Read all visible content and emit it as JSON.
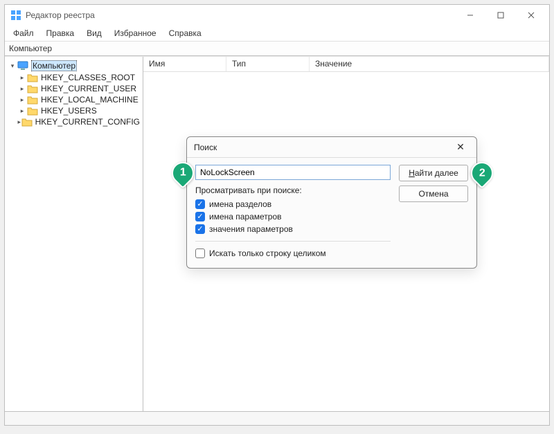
{
  "window": {
    "title": "Редактор реестра"
  },
  "menu": {
    "file": "Файл",
    "edit": "Правка",
    "view": "Вид",
    "favorites": "Избранное",
    "help": "Справка"
  },
  "address": "Компьютер",
  "tree": {
    "root": "Компьютер",
    "items": [
      "HKEY_CLASSES_ROOT",
      "HKEY_CURRENT_USER",
      "HKEY_LOCAL_MACHINE",
      "HKEY_USERS",
      "HKEY_CURRENT_CONFIG"
    ]
  },
  "columns": {
    "name": "Имя",
    "type": "Тип",
    "value": "Значение"
  },
  "dialog": {
    "title": "Поиск",
    "input_value": "NoLockScreen",
    "group_label": "Просматривать при поиске:",
    "cb_keys": "имена разделов",
    "cb_values": "имена параметров",
    "cb_data": "значения параметров",
    "cb_whole": "Искать только строку целиком",
    "find_next_u": "Н",
    "find_next_rest": "айти далее",
    "cancel": "Отмена",
    "checked": {
      "keys": true,
      "values": true,
      "data": true,
      "whole": false
    }
  },
  "annotations": {
    "one": "1",
    "two": "2"
  }
}
